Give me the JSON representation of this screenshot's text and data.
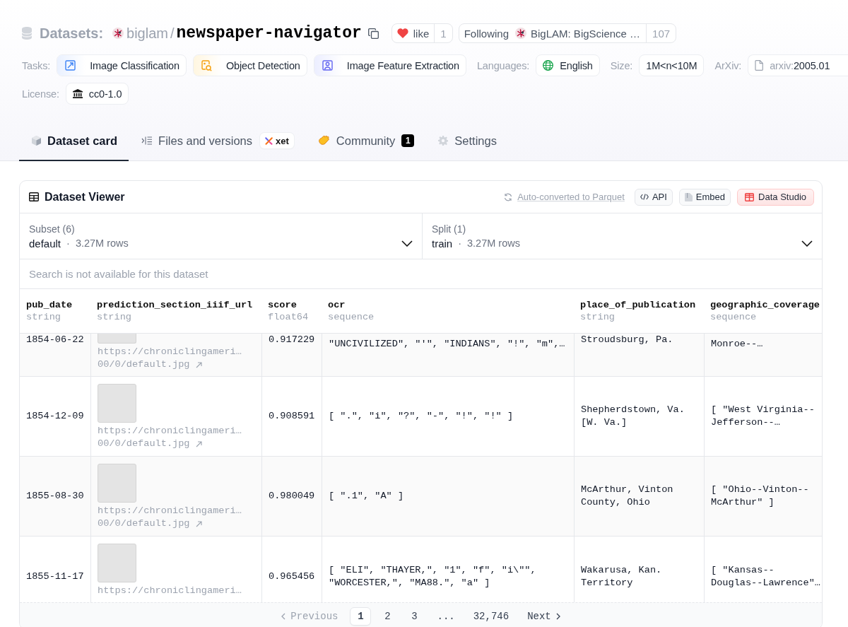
{
  "header": {
    "section": "Datasets:",
    "owner": "biglam",
    "separator": "/",
    "name": "newspaper-navigator",
    "like": {
      "label": "like",
      "count": "1"
    },
    "follow": {
      "label": "Following",
      "org": "BigLAM: BigScience …",
      "count": "107"
    }
  },
  "tag_rows": [
    [
      {
        "kind": "tasks",
        "label": "Tasks:",
        "chips": [
          {
            "text": "Image Classification"
          },
          {
            "text": "Object Detection"
          },
          {
            "text": "Image Feature Extraction"
          }
        ]
      },
      {
        "kind": "languages",
        "label": "Languages:",
        "chips": [
          {
            "text": "English"
          }
        ]
      },
      {
        "kind": "size",
        "label": "Size:",
        "chips": [
          {
            "text": "1M<n<10M"
          }
        ]
      },
      {
        "kind": "arxiv",
        "label": "ArXiv:",
        "chips": [
          {
            "prefix": "arxiv:",
            "text": "2005.01"
          }
        ]
      }
    ],
    [
      {
        "kind": "license",
        "label": "License:",
        "chips": [
          {
            "text": "cc0-1.0"
          }
        ]
      }
    ]
  ],
  "tabs": [
    {
      "label": "Dataset card",
      "selected": true
    },
    {
      "label": "Files and versions",
      "selected": false,
      "badge": "xet"
    },
    {
      "label": "Community",
      "selected": false,
      "count": "1"
    },
    {
      "label": "Settings",
      "selected": false
    }
  ],
  "viewer": {
    "title": "Dataset Viewer",
    "parquet_link": "Auto-converted to Parquet",
    "buttons": [
      {
        "label": "API",
        "kind": "plain"
      },
      {
        "label": "Embed",
        "kind": "plain"
      },
      {
        "label": "Data Studio",
        "kind": "accent"
      }
    ],
    "subset": {
      "label": "Subset (6)",
      "value": "default",
      "separator": "·",
      "rows": "3.27M rows"
    },
    "split": {
      "label": "Split (1)",
      "value": "train",
      "separator": "·",
      "rows": "3.27M rows"
    },
    "search": {
      "placeholder": "Search is not available for this dataset"
    },
    "table": {
      "columns": [
        {
          "name": "pub_date",
          "type": "string"
        },
        {
          "name": "prediction_section_iiif_url",
          "type": "string"
        },
        {
          "name": "score",
          "type": "float64"
        },
        {
          "name": "ocr",
          "type": "sequence"
        },
        {
          "name": "place_of_publication",
          "type": "string"
        },
        {
          "name": "geographic_coverage",
          "type": "sequence"
        }
      ],
      "rows": [
        {
          "kind": "clipped_top",
          "pub_date": "1854-06-22",
          "url_head": "https://chroniclingameri…",
          "url_tail": "00/0/default.jpg",
          "score": "0.917229",
          "ocr": "\"UNCIVILIZED\", \"'\", \"INDIANS\", \"!\", \"m\",…",
          "place_of_publication": "Stroudsburg, Pa.",
          "geographic_coverage": "Monroe--…"
        },
        {
          "kind": "full",
          "pub_date": "1854-12-09",
          "url_head": "https://chroniclingameri…",
          "url_tail": "00/0/default.jpg",
          "score": "0.908591",
          "ocr": "[ \".\", \"i\", \"?\", \"-\", \"!\", \"!\" ]",
          "place_of_publication": "Shepherdstown, Va. [W. Va.]",
          "geographic_coverage": "[ \"West Virginia--\nJefferson--…"
        },
        {
          "kind": "full",
          "pub_date": "1855-08-30",
          "url_head": "https://chroniclingameri…",
          "url_tail": "00/0/default.jpg",
          "score": "0.980049",
          "ocr": "[ \".1\", \"A\" ]",
          "place_of_publication": "McArthur, Vinton County, Ohio",
          "geographic_coverage": "[ \"Ohio--Vinton--\nMcArthur\" ]"
        },
        {
          "kind": "clipped_bottom",
          "pub_date": "1855-11-17",
          "url_head": "https://chroniclingameri…",
          "score": "0.965456",
          "ocr": "[ \"ELI\", \"THAYER,\", \"1\", \"f\", \"i\\\"\", \"WORCESTER,\", \"MA88.\", \"a\" ]",
          "place_of_publication": "Wakarusa, Kan. Territory",
          "geographic_coverage": "[ \"Kansas--\nDouglas--Lawrence\"…"
        }
      ]
    },
    "pagination": {
      "previous": {
        "label": "Previous",
        "disabled": true
      },
      "pages": [
        {
          "label": "1",
          "selected": true
        },
        {
          "label": "2",
          "selected": false
        },
        {
          "label": "3",
          "selected": false
        },
        {
          "label": "...",
          "selected": false
        },
        {
          "label": "32,746",
          "selected": false
        }
      ],
      "next": {
        "label": "Next",
        "disabled": false
      }
    }
  }
}
